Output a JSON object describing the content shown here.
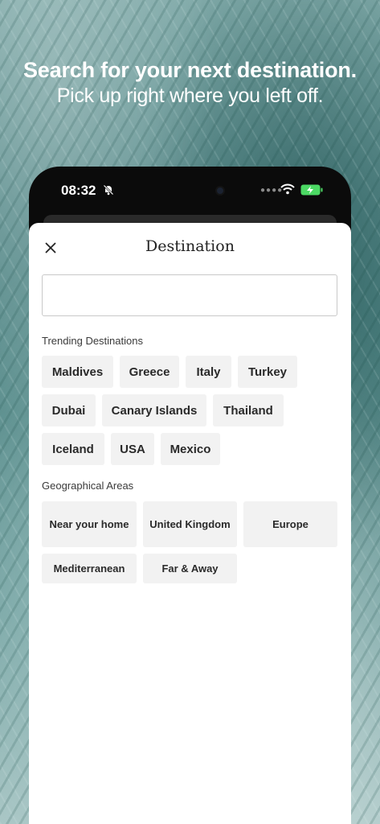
{
  "promo": {
    "headline": "Search for your next destination.",
    "subheadline": "Pick up right where you left off."
  },
  "status_bar": {
    "time": "08:32",
    "icons": [
      "bell-slash-icon",
      "signal-dots-icon",
      "wifi-icon",
      "battery-charging-icon"
    ],
    "battery_color": "#4cd964"
  },
  "sheet": {
    "title": "Destination",
    "close_icon": "close-icon",
    "search": {
      "value": "",
      "placeholder": ""
    },
    "trending": {
      "label": "Trending Destinations",
      "items": [
        "Maldives",
        "Greece",
        "Italy",
        "Turkey",
        "Dubai",
        "Canary Islands",
        "Thailand",
        "Iceland",
        "USA",
        "Mexico"
      ]
    },
    "areas": {
      "label": "Geographical Areas",
      "items": [
        "Near your home",
        "United Kingdom",
        "Europe",
        "Mediterranean",
        "Far & Away"
      ]
    }
  }
}
